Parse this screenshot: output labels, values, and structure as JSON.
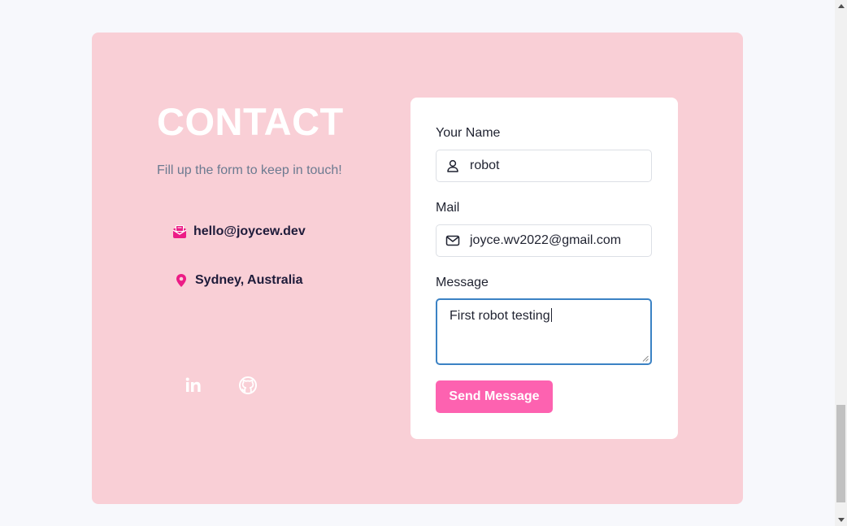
{
  "contact": {
    "heading": "CONTACT",
    "subtitle": "Fill up the form to keep in touch!",
    "email": "hello@joycew.dev",
    "location": "Sydney, Australia",
    "icons": {
      "email": "mail-open-icon",
      "location": "map-pin-icon",
      "linkedin": "linkedin-icon",
      "github": "github-icon"
    }
  },
  "form": {
    "name_label": "Your Name",
    "name_value": "robot",
    "mail_label": "Mail",
    "mail_value": "joyce.wv2022@gmail.com",
    "message_label": "Message",
    "message_value": "First robot testing",
    "submit_label": "Send Message",
    "icons": {
      "name": "user-icon",
      "mail": "envelope-icon"
    }
  },
  "colors": {
    "card_background": "#f9cfd6",
    "accent": "#fd62b0",
    "icon_accent": "#ec1c86",
    "focus_border": "#3b82c4"
  }
}
